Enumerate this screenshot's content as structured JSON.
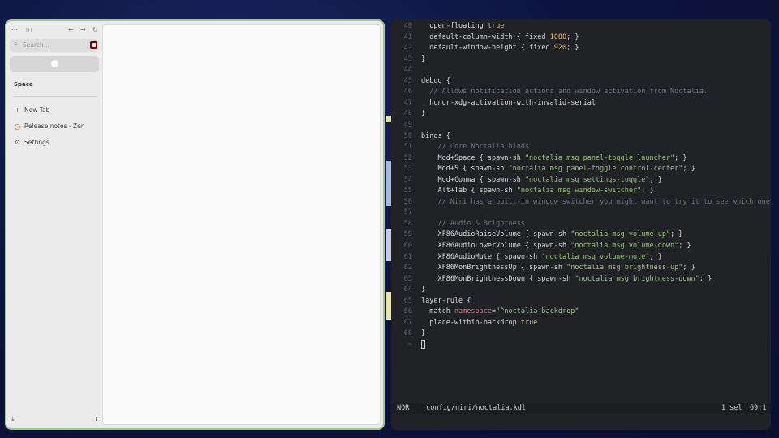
{
  "browser": {
    "search_placeholder": "Search...",
    "space_label": "Space",
    "items": [
      {
        "label": "New Tab",
        "icon": "plus-icon"
      },
      {
        "label": "Release notes - Zen",
        "icon": "zen-icon"
      },
      {
        "label": "Settings",
        "icon": "gear-icon"
      }
    ]
  },
  "editor": {
    "lines": [
      {
        "n": "40",
        "html": "  open-floating <span class='c-bool'>true</span>"
      },
      {
        "n": "41",
        "html": "  default-column-width { fixed <span class='c-num'>1080</span>; }"
      },
      {
        "n": "42",
        "html": "  default-window-height { fixed <span class='c-num'>920</span>; }"
      },
      {
        "n": "43",
        "html": "}"
      },
      {
        "n": "44",
        "html": ""
      },
      {
        "n": "45",
        "html": "debug {"
      },
      {
        "n": "46",
        "html": "  <span class='c-com'>// Allows notification actions and window activation from Noctalia.</span>"
      },
      {
        "n": "47",
        "html": "  honor-xdg-activation-with-invalid-serial"
      },
      {
        "n": "48",
        "html": "}"
      },
      {
        "n": "49",
        "html": ""
      },
      {
        "n": "50",
        "html": "binds {"
      },
      {
        "n": "51",
        "html": "    <span class='c-com'>// Core Noctalia binds</span>"
      },
      {
        "n": "52",
        "html": "    Mod+Space { spawn-sh <span class='c-str'>\"noctalia msg panel-toggle launcher\"</span>; }"
      },
      {
        "n": "53",
        "html": "    Mod+S { spawn-sh <span class='c-str'>\"noctalia msg panel-toggle control-center\"</span>; }"
      },
      {
        "n": "54",
        "html": "    Mod+Comma { spawn-sh <span class='c-str'>\"noctalia msg settings-toggle\"</span>; }"
      },
      {
        "n": "55",
        "html": "    Alt+Tab { spawn-sh <span class='c-str'>\"noctalia msg window-switcher\"</span>; }"
      },
      {
        "n": "56",
        "html": "    <span class='c-com'>// Niri has a built-in window switcher you might want to try it to see which one y</span>"
      },
      {
        "n": "57",
        "html": ""
      },
      {
        "n": "58",
        "html": "    <span class='c-com'>// Audio &amp; Brightness</span>"
      },
      {
        "n": "59",
        "html": "    XF86AudioRaiseVolume { spawn-sh <span class='c-str'>\"noctalia msg volume-up\"</span>; }"
      },
      {
        "n": "60",
        "html": "    XF86AudioLowerVolume { spawn-sh <span class='c-str'>\"noctalia msg volume-down\"</span>; }"
      },
      {
        "n": "61",
        "html": "    XF86AudioMute { spawn-sh <span class='c-str'>\"noctalia msg volume-mute\"</span>; }"
      },
      {
        "n": "62",
        "html": "    XF86MonBrightnessUp { spawn-sh <span class='c-str'>\"noctalia msg brightness-up\"</span>; }"
      },
      {
        "n": "63",
        "html": "    XF86MonBrightnessDown { spawn-sh <span class='c-str'>\"noctalia msg brightness-down\"</span>; }"
      },
      {
        "n": "64",
        "html": "}"
      },
      {
        "n": "65",
        "html": "layer-rule {"
      },
      {
        "n": "66",
        "html": "  match <span class='c-attr'>namespace</span>=<span class='c-str'>\"^noctalia-backdrop\"</span>"
      },
      {
        "n": "67",
        "html": "  place-within-backdrop <span class='c-bool'>true</span>"
      },
      {
        "n": "68",
        "html": "}"
      },
      {
        "n": "~",
        "html": "<span class='cursor'></span>"
      }
    ],
    "status": {
      "mode": "NOR",
      "file": ".config/niri/noctalia.kdl",
      "selection": "1 sel",
      "position": "69:1"
    }
  }
}
